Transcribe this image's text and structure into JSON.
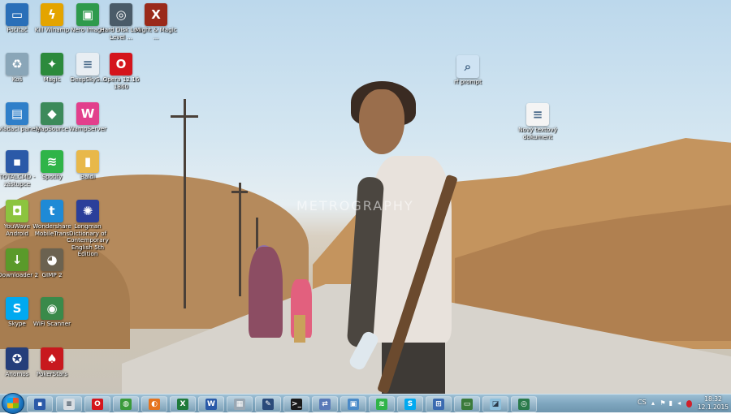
{
  "desktop": {
    "watermark": "METROGRAPHY",
    "icons": [
      {
        "label": "Počítač",
        "icon": "computer-icon",
        "color": "#2a6fb8",
        "glyph": "▭"
      },
      {
        "label": "Kill Winamp",
        "icon": "winamp-lightning-icon",
        "color": "#e4a400",
        "glyph": "ϟ"
      },
      {
        "label": "Nero Image",
        "icon": "nero-image-icon",
        "color": "#2e9a4c",
        "glyph": "▣"
      },
      {
        "label": "Hard Disk Low Level ...",
        "icon": "harddisk-tool-icon",
        "color": "#4a5b68",
        "glyph": "◎"
      },
      {
        "label": "Might & Magic ...",
        "icon": "might-magic-icon",
        "color": "#9a2a1a",
        "glyph": "X"
      },
      {
        "label": "Koš",
        "icon": "recycle-bin-icon",
        "color": "#8aa6b8",
        "glyph": "♻"
      },
      {
        "label": "Magic",
        "icon": "magic-game-icon",
        "color": "#2c8a3c",
        "glyph": "✦"
      },
      {
        "label": "DeepSkyS...",
        "icon": "deepsky-document-icon",
        "color": "#e8eef3",
        "glyph": "≡"
      },
      {
        "label": "Opera 12.16 1860",
        "icon": "opera-icon",
        "color": "#d4141c",
        "glyph": "O"
      },
      {
        "label": "Ovládací panely",
        "icon": "control-panel-icon",
        "color": "#2f7fc9",
        "glyph": "▤"
      },
      {
        "label": "MapSource",
        "icon": "mapsource-icon",
        "color": "#3c8a5a",
        "glyph": "◆"
      },
      {
        "label": "WampServer",
        "icon": "wampserver-icon",
        "color": "#e23f8c",
        "glyph": "W"
      },
      {
        "label": "TOTALCMD - zástupce",
        "icon": "floppy-icon",
        "color": "#2b5aa8",
        "glyph": "▪"
      },
      {
        "label": "Spotify",
        "icon": "spotify-icon",
        "color": "#2fb448",
        "glyph": "≋"
      },
      {
        "label": "Baldi",
        "icon": "folder-icon",
        "color": "#e8b84a",
        "glyph": "▮"
      },
      {
        "label": "YouWave Android",
        "icon": "android-icon",
        "color": "#8cc43f",
        "glyph": "◘"
      },
      {
        "label": "Wondershare MobileTrans",
        "icon": "mobiletrans-icon",
        "color": "#1f8ad6",
        "glyph": "t"
      },
      {
        "label": "Longman Dictionary of Contemporary English 5th Edition",
        "icon": "longman-dictionary-icon",
        "color": "#2a3f9a",
        "glyph": "✺"
      },
      {
        "label": "JDownloader 2",
        "icon": "jdownloader-icon",
        "color": "#5a9a2a",
        "glyph": "↓"
      },
      {
        "label": "GIMP 2",
        "icon": "gimp-icon",
        "color": "#6b6250",
        "glyph": "◕"
      },
      {
        "label": "Skype",
        "icon": "skype-icon",
        "color": "#00a9f0",
        "glyph": "S"
      },
      {
        "label": "WiFi Scanner",
        "icon": "wifi-scanner-icon",
        "color": "#3a8a4a",
        "glyph": "◉"
      },
      {
        "label": "Anomos",
        "icon": "anomos-seal-icon",
        "color": "#243e7a",
        "glyph": "✪"
      },
      {
        "label": "PokerStars",
        "icon": "pokerstars-icon",
        "color": "#c8181e",
        "glyph": "♠"
      },
      {
        "label": "rf prompt",
        "icon": "prompt-shortcut-icon",
        "color": "#cfe3f3",
        "glyph": "⌕"
      },
      {
        "label": "Nový textový dokument",
        "icon": "text-document-icon",
        "color": "#f4f4f4",
        "glyph": "≡"
      }
    ]
  },
  "taskbar": {
    "start_icon": "windows-start-icon",
    "pinned": [
      {
        "name": "totalcmd-floppy",
        "icon": "floppy-icon",
        "color": "#2b5aa8",
        "glyph": "▪"
      },
      {
        "name": "notepad",
        "icon": "notepad-icon",
        "color": "#d8dde2",
        "glyph": "≡"
      },
      {
        "name": "opera",
        "icon": "opera-icon",
        "color": "#d4141c",
        "glyph": "O"
      },
      {
        "name": "chrome",
        "icon": "chrome-icon",
        "color": "#3a9a3a",
        "glyph": "◍"
      },
      {
        "name": "firefox",
        "icon": "firefox-icon",
        "color": "#e5731e",
        "glyph": "◐"
      },
      {
        "name": "excel",
        "icon": "excel-icon",
        "color": "#1f7a3a",
        "glyph": "X"
      },
      {
        "name": "word",
        "icon": "word-icon",
        "color": "#2a5aa8",
        "glyph": "W"
      },
      {
        "name": "calculator",
        "icon": "calculator-icon",
        "color": "#9aa8b4",
        "glyph": "▦"
      },
      {
        "name": "pen-tool",
        "icon": "pen-icon",
        "color": "#2a4a7a",
        "glyph": "✎"
      },
      {
        "name": "command-prompt",
        "icon": "cmd-icon",
        "color": "#1a1a1a",
        "glyph": ">_"
      },
      {
        "name": "network-tool",
        "icon": "network-icon",
        "color": "#5a7ab8",
        "glyph": "⇄"
      },
      {
        "name": "remote-desktop",
        "icon": "remote-icon",
        "color": "#4a8ac8",
        "glyph": "▣"
      },
      {
        "name": "spotify",
        "icon": "spotify-icon",
        "color": "#2fb448",
        "glyph": "≋"
      },
      {
        "name": "skype",
        "icon": "skype-icon",
        "color": "#00a9f0",
        "glyph": "S"
      },
      {
        "name": "network-share",
        "icon": "lan-icon",
        "color": "#3a6ab0",
        "glyph": "⊞"
      },
      {
        "name": "monitor",
        "icon": "monitor-icon",
        "color": "#3a7a3a",
        "glyph": "▭"
      },
      {
        "name": "window-app",
        "icon": "window-icon",
        "color": "#8ec0dc",
        "glyph": "◪"
      },
      {
        "name": "globe-app",
        "icon": "globe-icon",
        "color": "#2a7a4a",
        "glyph": "◎"
      }
    ],
    "tray": {
      "language": "CS",
      "clock_time": "18:32",
      "clock_date": "12.1.2015"
    }
  }
}
